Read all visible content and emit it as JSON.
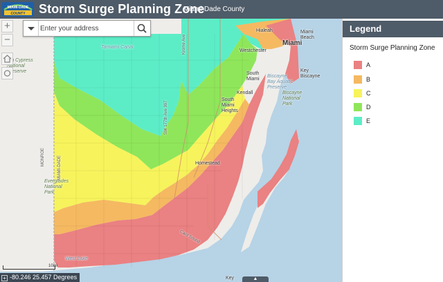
{
  "header": {
    "title": "Storm Surge Planning Zone",
    "subtitle": "Miami-Dade County",
    "logo_text": "MIAMI-DADE COUNTY"
  },
  "search": {
    "placeholder": "Enter your address",
    "value": ""
  },
  "map": {
    "zoom_in_label": "+",
    "zoom_out_label": "−",
    "coordinates": "-80.246 25.457 Degrees",
    "scale_label": "10mi",
    "attribution_toggle": "▲",
    "place_labels": [
      {
        "id": "hialeah",
        "text": "Hialeah",
        "kind": "place"
      },
      {
        "id": "miami-beach",
        "text": "Miami Beach",
        "kind": "place"
      },
      {
        "id": "westchester",
        "text": "Westchester",
        "kind": "place"
      },
      {
        "id": "miami",
        "text": "Miami",
        "kind": "place"
      },
      {
        "id": "south-miami",
        "text": "South Miami",
        "kind": "place"
      },
      {
        "id": "key-biscayne",
        "text": "Key Biscayne",
        "kind": "place"
      },
      {
        "id": "biscayne-aquatic",
        "text": "Biscayne Bay Aquatic Preserve",
        "kind": "water"
      },
      {
        "id": "kendall",
        "text": "Kendall",
        "kind": "place"
      },
      {
        "id": "south-miami-heights",
        "text": "South Miami Heights",
        "kind": "place"
      },
      {
        "id": "biscayne-np",
        "text": "Biscayne National Park",
        "kind": "park"
      },
      {
        "id": "homestead",
        "text": "Homestead",
        "kind": "place"
      },
      {
        "id": "tamiami-canal",
        "text": "Tamiami Canal",
        "kind": "water"
      },
      {
        "id": "big-cypress",
        "text": "Big Cypress National Preserve",
        "kind": "park"
      },
      {
        "id": "everglades-np",
        "text": "Everglades National Park",
        "kind": "park"
      },
      {
        "id": "monroe",
        "text": "MONROE",
        "kind": "road"
      },
      {
        "id": "miami-dade-county-line",
        "text": "MIAMI-DADE",
        "kind": "road"
      },
      {
        "id": "krome-ave",
        "text": "Krome Ave",
        "kind": "road"
      },
      {
        "id": "ave-177",
        "text": "SW 177th Ave 997",
        "kind": "road"
      },
      {
        "id": "card-sound",
        "text": "Card Sound",
        "kind": "road"
      },
      {
        "id": "key-largo",
        "text": "Key",
        "kind": "place"
      },
      {
        "id": "west-lake",
        "text": "West Lake",
        "kind": "water"
      }
    ]
  },
  "legend": {
    "header": "Legend",
    "title": "Storm Surge Planning Zone",
    "items": [
      {
        "label": "A",
        "color": "#ea8182"
      },
      {
        "label": "B",
        "color": "#f5b961"
      },
      {
        "label": "C",
        "color": "#f7f35c"
      },
      {
        "label": "D",
        "color": "#8fe65a"
      },
      {
        "label": "E",
        "color": "#5cedc7"
      }
    ]
  },
  "colors": {
    "header_bg": "#4e5b68",
    "water": "#b7d3e6",
    "land": "#eeedea",
    "zone_a": "#ea8182",
    "zone_b": "#f5b961",
    "zone_c": "#f7f35c",
    "zone_d": "#8fe65a",
    "zone_e": "#5cedc7"
  }
}
